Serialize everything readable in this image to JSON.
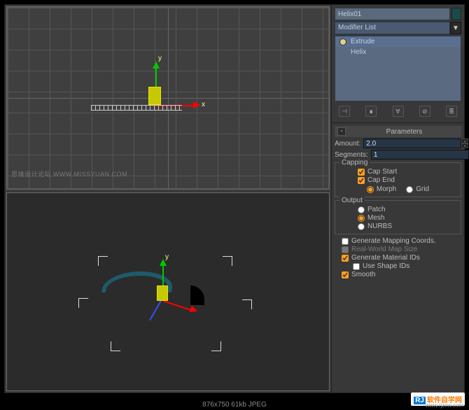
{
  "object": {
    "name": "Helix01"
  },
  "modifier_list": {
    "label": "Modifier List"
  },
  "stack": {
    "items": [
      "Extrude",
      "Helix"
    ]
  },
  "stack_tools": [
    "pin-icon",
    "show-end-result-icon",
    "make-unique-icon",
    "remove-modifier-icon",
    "configure-icon"
  ],
  "rollout": {
    "title": "Parameters",
    "amount": {
      "label": "Amount:",
      "value": "2.0"
    },
    "segments": {
      "label": "Segments:",
      "value": "1"
    },
    "capping": {
      "title": "Capping",
      "cap_start": {
        "label": "Cap Start",
        "checked": true
      },
      "cap_end": {
        "label": "Cap End",
        "checked": true
      },
      "type": {
        "morph": "Morph",
        "grid": "Grid",
        "value": "morph"
      }
    },
    "output": {
      "title": "Output",
      "patch": "Patch",
      "mesh": "Mesh",
      "nurbs": "NURBS",
      "value": "mesh"
    },
    "gen_map": {
      "label": "Generate Mapping Coords.",
      "checked": false
    },
    "real_world": {
      "label": "Real-World Map Size",
      "checked": false
    },
    "gen_mat": {
      "label": "Generate Material IDs",
      "checked": true
    },
    "use_shape": {
      "label": "Use Shape IDs",
      "checked": false
    },
    "smooth": {
      "label": "Smooth",
      "checked": true
    }
  },
  "axis": {
    "x": "x",
    "y": "y"
  },
  "watermark": "思缘设计论坛 WWW.MISSYUAN.COM",
  "logo": {
    "cn": "软件自学网",
    "url": "www.rjzxw.com"
  },
  "caption": "876x750 61kb JPEG"
}
